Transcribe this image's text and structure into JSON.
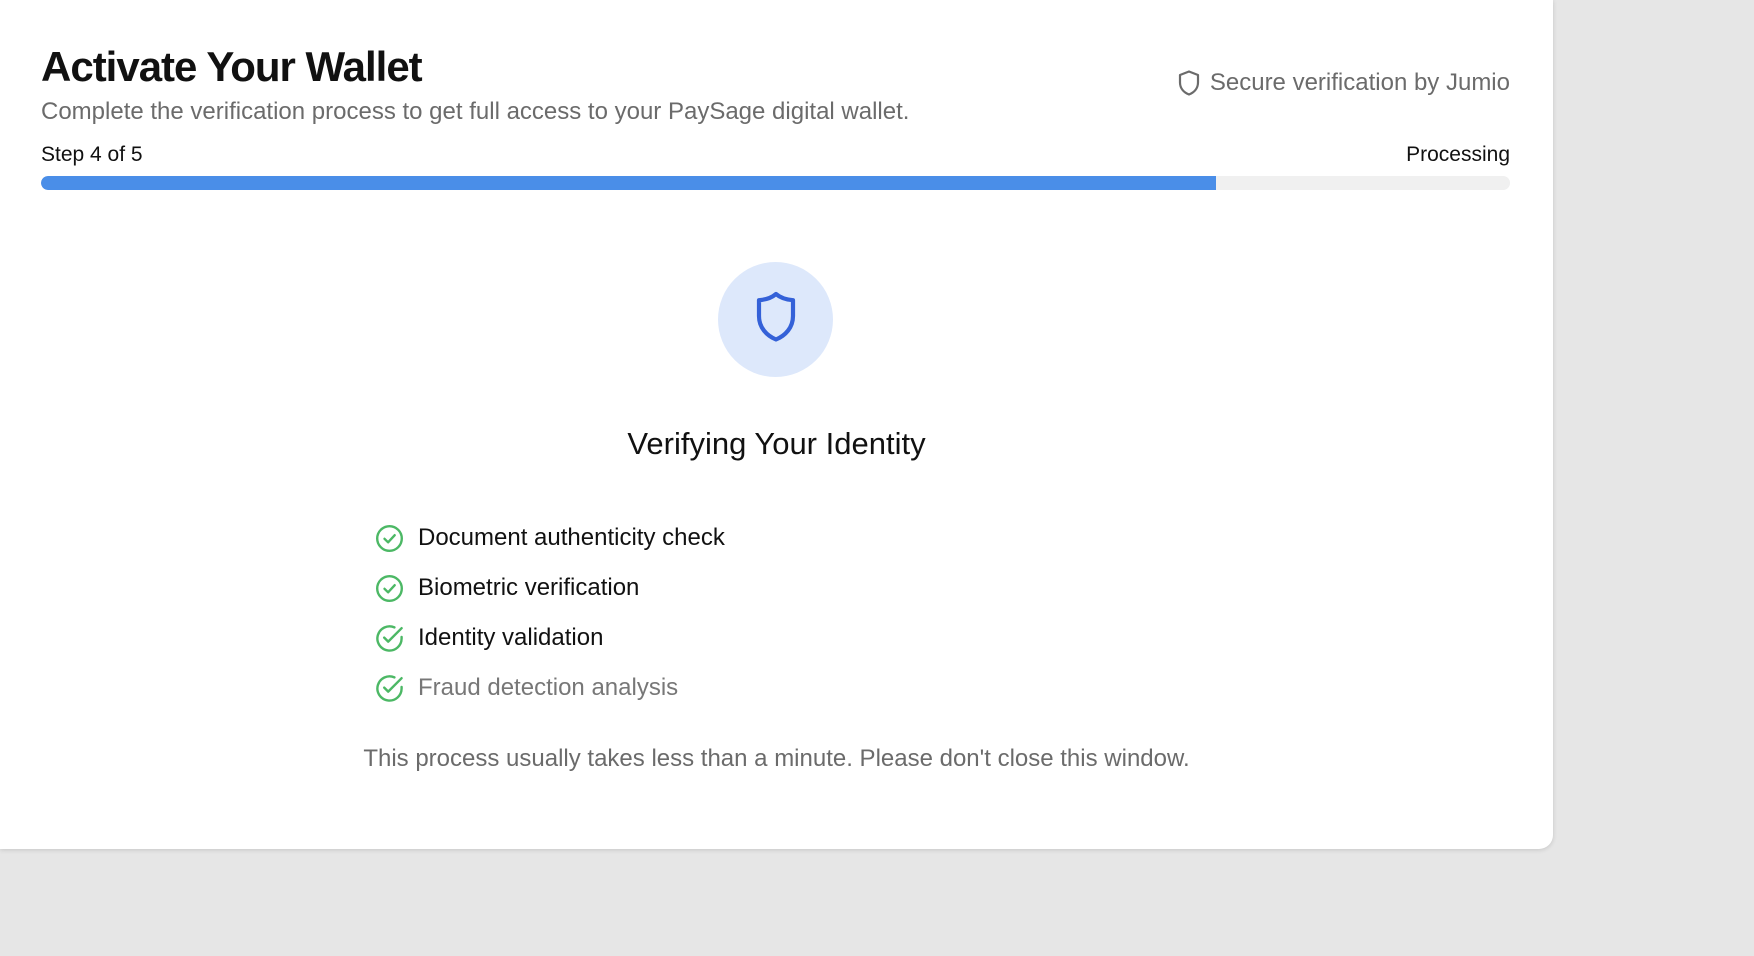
{
  "header": {
    "title": "Activate Your Wallet",
    "subtitle": "Complete the verification process to get full access to your PaySage digital wallet.",
    "secure_badge": {
      "icon": "shield-icon",
      "label": "Secure verification by Jumio"
    }
  },
  "progress": {
    "step_label": "Step 4 of 5",
    "status": "Processing",
    "fraction": 0.8,
    "fill_color": "#4a8ee8",
    "track_color": "#f0f0f0"
  },
  "verification": {
    "icon": "shield-icon",
    "icon_color": "#3461d8",
    "icon_bg_color": "#dde8fb",
    "heading": "Verifying Your Identity",
    "check_color": "#4cb865",
    "steps": [
      {
        "label": "Document authenticity check",
        "icon": "check-circle-icon",
        "state": "complete"
      },
      {
        "label": "Biometric verification",
        "icon": "check-circle-icon",
        "state": "complete"
      },
      {
        "label": "Identity validation",
        "icon": "circle-check-icon",
        "state": "complete"
      },
      {
        "label": "Fraud detection analysis",
        "icon": "circle-check-icon",
        "state": "in-progress"
      }
    ],
    "note": "This process usually takes less than a minute. Please don't close this window."
  }
}
